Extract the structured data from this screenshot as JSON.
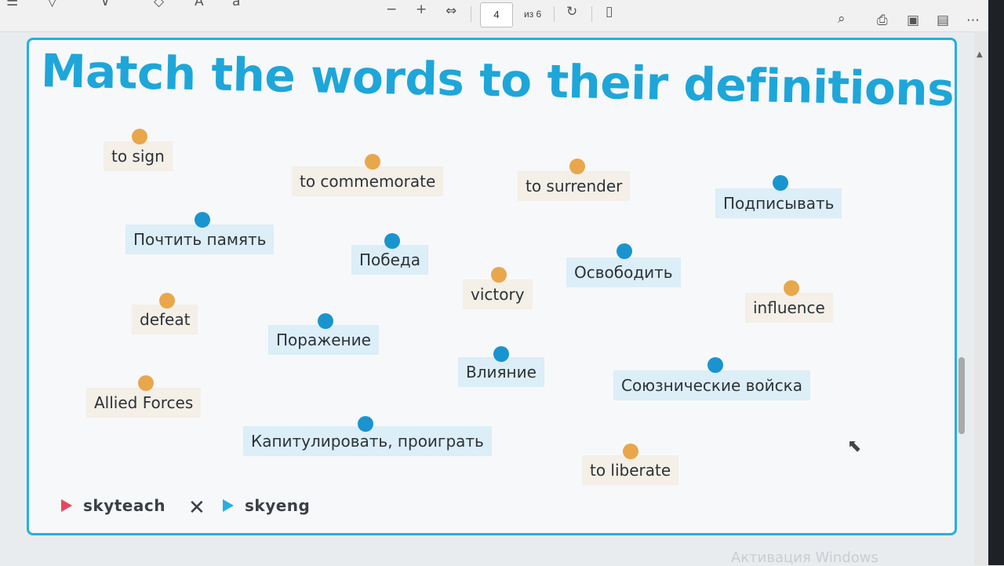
{
  "toolbar": {
    "page_current": "4",
    "page_total": "из 6"
  },
  "slide": {
    "title": "Match the words to their definitions",
    "english_words": [
      "to sign",
      "to commemorate",
      "to surrender",
      "victory",
      "defeat",
      "influence",
      "Allied Forces",
      "to liberate"
    ],
    "russian_words": [
      "Подписывать",
      "Почтить память",
      "Победа",
      "Освободить",
      "Поражение",
      "Влияние",
      "Союзнические войска",
      "Капитулировать, проиграть"
    ],
    "footer": {
      "logo_left": "skyteach",
      "logo_right": "skyeng"
    }
  },
  "watermark": "Активация Windows",
  "colors": {
    "accent": "#1ea6d9",
    "english_dot": "#e9a74b",
    "russian_dot": "#1a94cf",
    "english_card": "#f4efe7",
    "russian_card": "#dceef7"
  },
  "icons": [
    "minus-icon",
    "plus-icon",
    "fit-width-icon",
    "rotate-icon",
    "page-view-icon",
    "search-icon",
    "print-icon",
    "save-icon",
    "save-as-icon",
    "more-icon",
    "cursor-icon"
  ]
}
